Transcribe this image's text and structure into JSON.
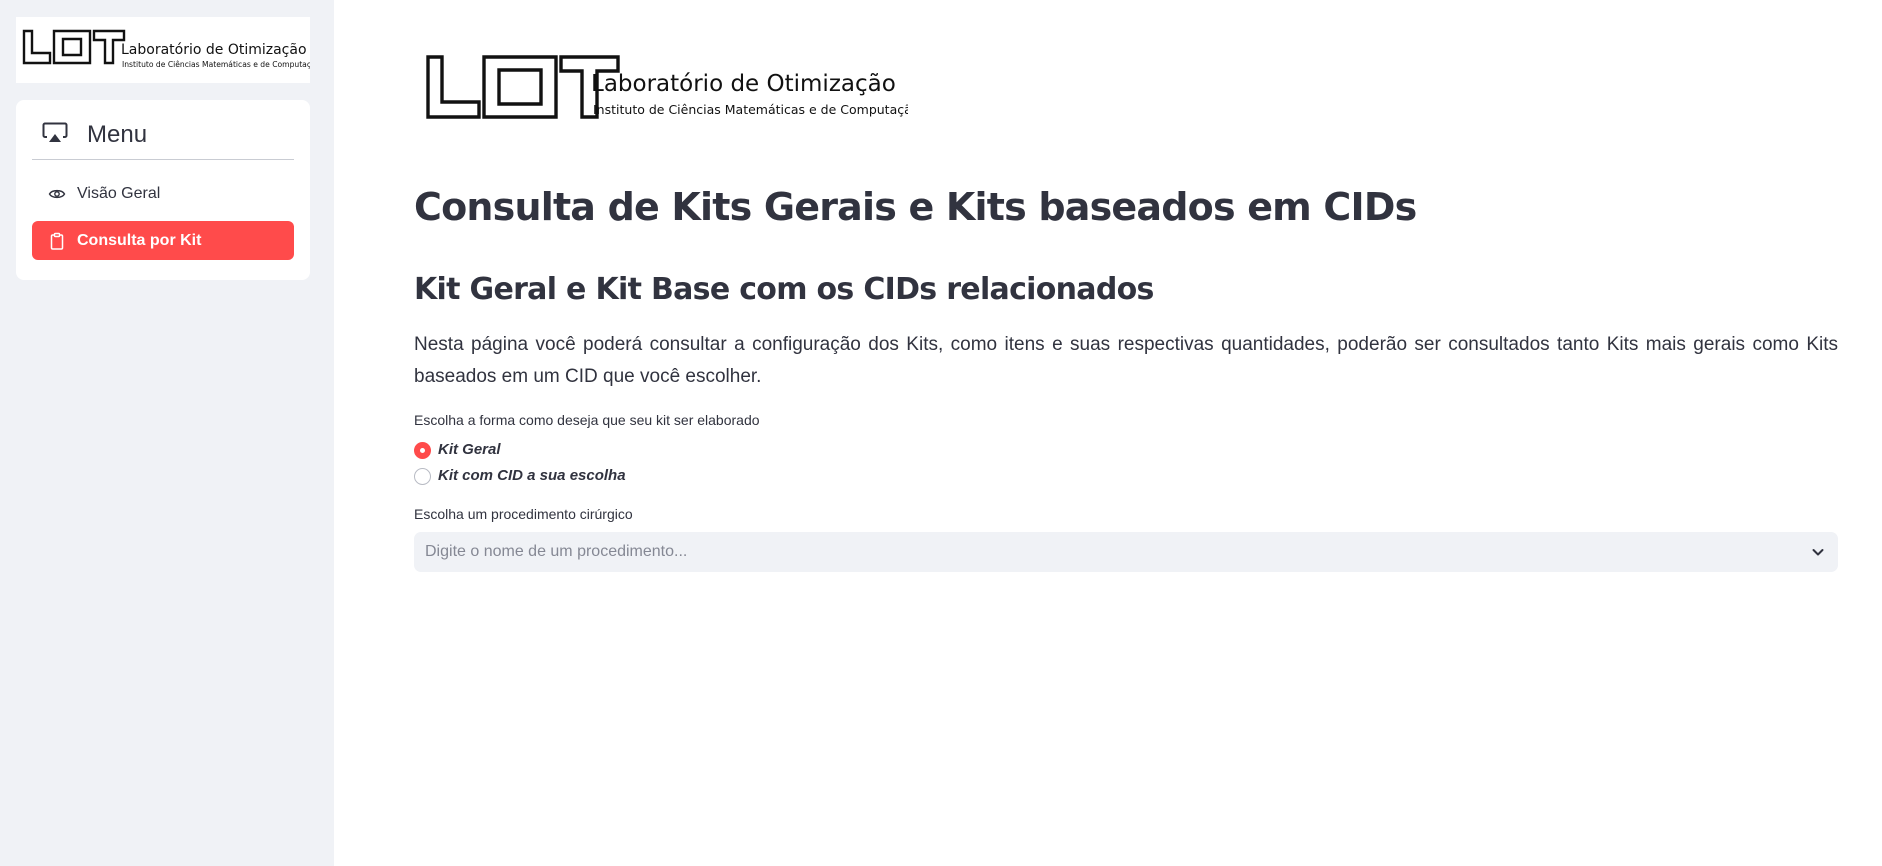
{
  "brand": {
    "lab_name": "Laboratório de Otimização",
    "institute": "Instituto de Ciências Matemáticas e de Computação",
    "logo_letters": "LOT"
  },
  "sidebar": {
    "menu_icon": "airplay-icon",
    "menu_title": "Menu",
    "items": [
      {
        "label": "Visão Geral",
        "icon": "eye-icon",
        "active": false
      },
      {
        "label": "Consulta por Kit",
        "icon": "clipboard-icon",
        "active": true
      }
    ]
  },
  "main": {
    "title": "Consulta de Kits Gerais e Kits baseados em CIDs",
    "subtitle": "Kit Geral e Kit Base com os CIDs relacionados",
    "description": "Nesta página você poderá consultar a configuração dos Kits, como itens e suas respectivas quantidades, poderão ser consultados tanto Kits mais gerais como Kits baseados em um CID que você escolher.",
    "kit_choice": {
      "label": "Escolha a forma como deseja que seu kit ser elaborado",
      "options": [
        "Kit Geral",
        "Kit com CID a sua escolha"
      ],
      "selected": "Kit Geral"
    },
    "procedure": {
      "label": "Escolha um procedimento cirúrgico",
      "placeholder": "Digite o nome de um procedimento...",
      "icon": "chevron-down-icon"
    }
  },
  "colors": {
    "accent": "#ff4b4b",
    "sidebar_bg": "#f0f2f6",
    "text": "#31333f"
  }
}
